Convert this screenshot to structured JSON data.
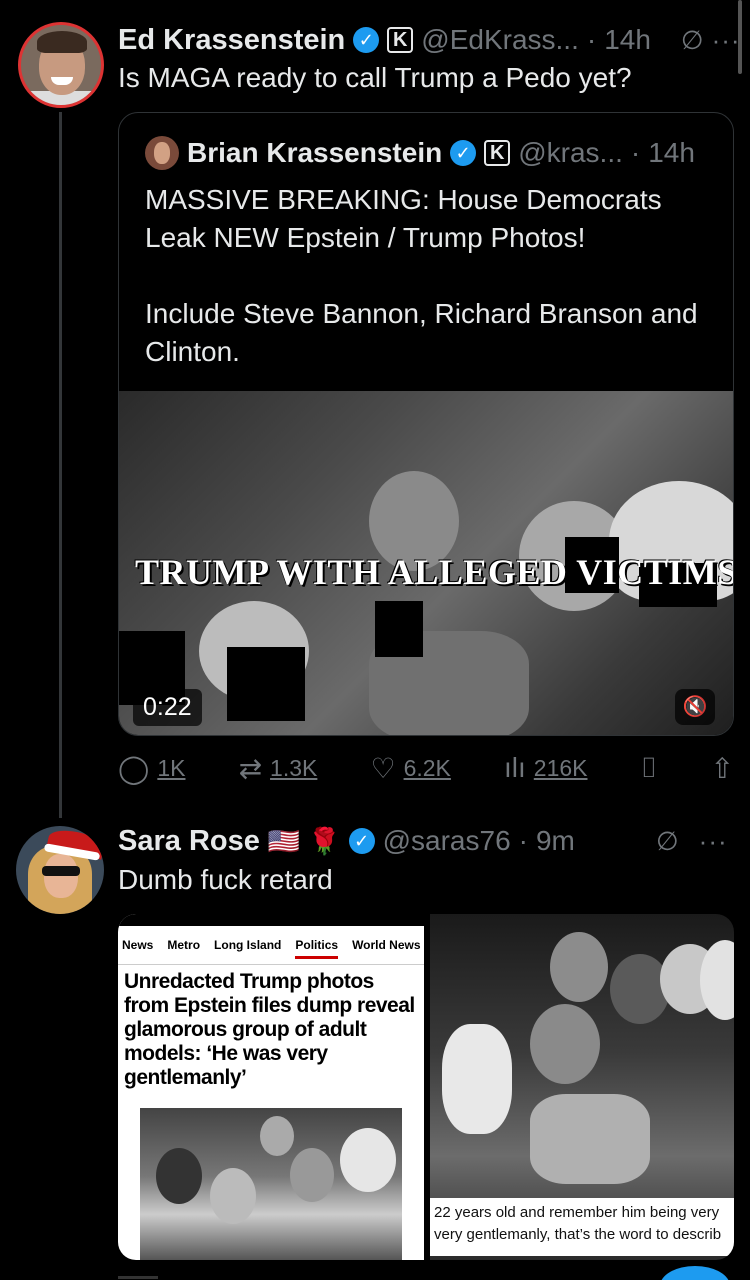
{
  "tweet1": {
    "author_name": "Ed Krassenstein",
    "verified_icon": "verified-badge-icon",
    "org_badge": "K",
    "handle": "@EdKrass...",
    "separator": "·",
    "time": "14h",
    "text": "Is MAGA ready to call Trump a Pedo yet?"
  },
  "quote": {
    "author_name": "Brian Krassenstein",
    "org_badge": "K",
    "handle": "@kras...",
    "separator": "·",
    "time": "14h",
    "text": "MASSIVE BREAKING:  House Democrats Leak NEW Epstein / Trump Photos!\n\nInclude Steve Bannon, Richard Branson and Clinton.",
    "video": {
      "caption": "TRUMP WITH ALLEGED VICTIMS",
      "duration": "0:22",
      "mute_icon": "muted-speaker-icon"
    }
  },
  "actions": {
    "replies": "1K",
    "reposts": "1.3K",
    "likes": "6.2K",
    "views": "216K"
  },
  "tweet3": {
    "author_name": "Sara Rose",
    "flag_emoji": "🇺🇸",
    "rose_emoji": "🌹",
    "handle": "@saras76",
    "separator": "·",
    "time": "9m",
    "text": "Dumb fuck retard",
    "article": {
      "nav": [
        "News",
        "Metro",
        "Long Island",
        "Politics",
        "World News"
      ],
      "active_nav": "Politics",
      "headline": "Unredacted Trump photos from Epstein files dump reveal glamorous group of adult models: ‘He was very gentlemanly’"
    },
    "video_subtitle_1": "22 years old and remember him being very",
    "video_subtitle_2": "very gentlemanly, that’s the word to describ"
  },
  "colors": {
    "background": "#000000",
    "text": "#e7e9ea",
    "muted": "#71767b",
    "accent": "#1d9bf0"
  }
}
